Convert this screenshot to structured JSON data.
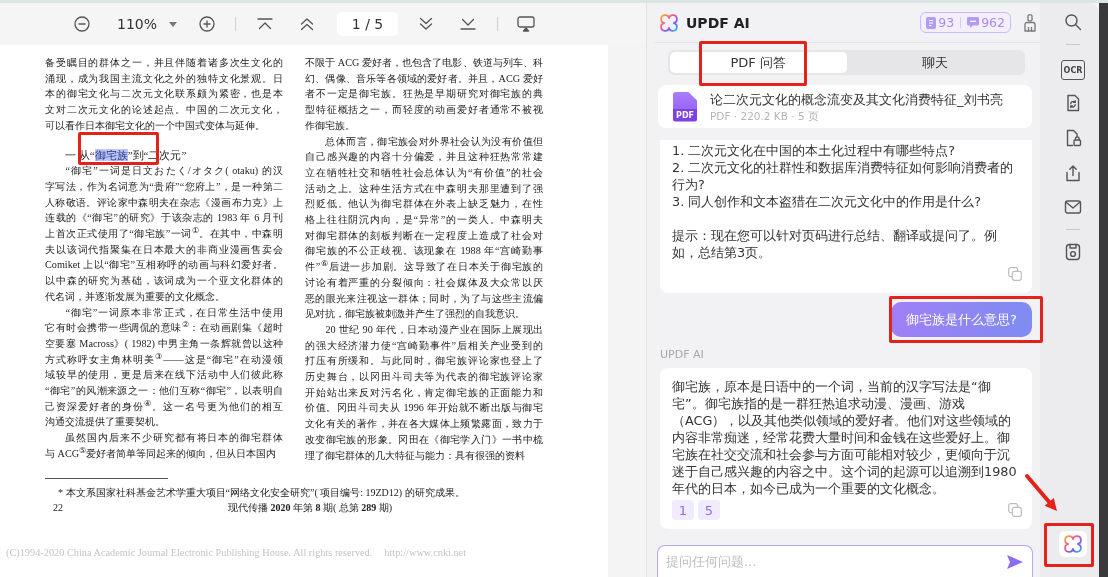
{
  "toolbar": {
    "zoom": "110%",
    "page": "1 / 5"
  },
  "pdf_page": {
    "columns": [
      {
        "blocks": [
          {
            "kind": "paragraph",
            "continued": true,
            "lines": [
              "备受瞩目的群体之一，并且伴随着诸多次生文化的",
              "涌现，成为我国主流文化之外的独特文化景观。日",
              "本的御宅文化与二次元文化联系颇为紧密，也是本",
              "文对二次元文化的论述起点。中国的二次元文化，",
              "可以看作日本御宅文化的一个中国式变体与延伸。"
            ]
          },
          {
            "kind": "heading",
            "segments": [
              {
                "text": "一 从“",
                "highlighted": false
              },
              {
                "text": "御宅族",
                "highlighted": true
              },
              {
                "text": "”到“二次元”",
                "highlighted": false
              }
            ]
          },
          {
            "kind": "paragraph",
            "continued": false,
            "lines": [
              "“御宅”一词是日文おたく/オタク( otaku) 的汉",
              "字写法，作为名词意为“贵府”“您府上”，是一种第二",
              "人称敬语。评论家中森明夫在杂志《漫画布力克》上",
              "连载的《“御宅”的研究》于该杂志的 1983 年 6 月刊",
              "上首次正式使用了“御宅族”一词$^{①}$。在其中，中森明",
              "夫以该词代指聚集在日本最大的非商业漫画售卖会",
              "Comiket 上以“御宅”互相称呼的动画与科幻爱好者。",
              "以中森的研究为基础，该词成为一个亚文化群体的",
              "代名词，并逐渐发展为重要的文化概念。"
            ]
          },
          {
            "kind": "paragraph",
            "continued": false,
            "lines": [
              "“御宅”一词原本非常正式，在日常生活中使用",
              "它有时会携带一些调侃的意味$^{②}$：在动画剧集《超时",
              "空要塞 Macross》( 1982) 中男主角一条辉就曾以这种",
              "方式称呼女主角林明美$^{③}$——这是“御宅”在动漫领",
              "域较早的使用，更是后来在线下活动中人们彼此称",
              "“御宅”的风潮来源之一：他们互称“御宅”，以表明自",
              "己资深爱好者的身份$^{④}$。这一名号更为他们的相互",
              "沟通交流提供了重要契机。"
            ]
          },
          {
            "kind": "paragraph",
            "continued": false,
            "lines": [
              "虽然国内后来不少研究都有将日本的御宅群体",
              "与 ACG$^{⑤}$爱好者简单等同起来的倾向，但从日本国内"
            ]
          }
        ]
      },
      {
        "blocks": [
          {
            "kind": "paragraph",
            "continued": true,
            "lines": [
              "不限于 ACG 爱好者，也包含了电影、铁道与列车、科",
              "幻、偶像、音乐等各领域的爱好者。并且，ACG 爱好",
              "者不一定是御宅族。狂热是早期研究对御宅族的典",
              "型特征概括之一，而轻度的动画爱好者通常不被视",
              "作御宅族。"
            ]
          },
          {
            "kind": "paragraph",
            "continued": false,
            "lines": [
              "总体而言，御宅族会对外界社会认为没有价值但",
              "自己感兴趣的内容十分偏爱，并且这种狂热常常建",
              "立在牺牲社交和牺牲社会总体认为“有价值”的社会",
              "活动之上。这种生活方式在中森明夫那里遭到了强",
              "烈贬低。他认为御宅群体在外表上缺乏魅力，在性",
              "格上往往阴沉内向，是“异常”的一类人。中森明夫",
              "对御宅群体的刻板判断在一定程度上造成了社会对",
              "御宅族的不公正歧视。该现象在 1988 年“宫崎勤事",
              "件”$^{⑥}$后进一步加剧。这导致了在日本关于御宅族的",
              "讨论有着严重的分裂倾向：社会媒体及大众常以厌",
              "恶的眼光来注视这一群体；同时，为了与这些主流偏",
              "见对抗，御宅族被刺激并产生了强烈的自我意识。"
            ]
          },
          {
            "kind": "paragraph",
            "continued": false,
            "lines": [
              "20 世纪 90 年代，日本动漫产业在国际上展现出",
              "的强大经济潜力使“宫崎勤事件”后相关产业受到的",
              "打压有所缓和。与此同时，御宅族评论家也登上了",
              "历史舞台，以冈田斗司夫等为代表的御宅族评论家",
              "开始站出来反对污名化，肯定御宅族的正面能力和",
              "价值。冈田斗司夫从 1996 年开始就不断出版与御宅",
              "文化有关的著作，并在各大媒体上频繁露面，致力于",
              "改变御宅族的形象。冈田在《御宅学入门》一书中梳",
              "理了御宅群体的几大特征与能力：具有很强的资料"
            ]
          }
        ]
      }
    ],
    "footnote": "* 本文系国家社科基金艺术学重大项目“网络文化安全研究”( 项目编号: 19ZD12) 的研究成果。",
    "page_number": "22",
    "journal": "现代传播 **2020** 年第 **8** 期( 总第 **289** 期)",
    "copyright": "(C)1994-2020 China Academic Journal Electronic Publishing House. All rights reserved.",
    "url": "http://www.cnki.net"
  },
  "ai_panel": {
    "title": "UPDF AI",
    "credits": {
      "documents": "93",
      "messages": "962"
    },
    "tabs": [
      {
        "label": "PDF 问答",
        "selected": true
      },
      {
        "label": "聊天",
        "selected": false
      }
    ],
    "file": {
      "icon_label": "PDF",
      "name": "论二次元文化的概念流变及其文化消费特征_刘书亮",
      "meta": "PDF · 220.2 KB · 5 页"
    },
    "messages": [
      {
        "kind": "assistant",
        "paragraphs": [
          [
            "1. 二次元文化在中国的本土化过程中有哪些特点?",
            "2. 二次元文化的社群性和数据库消费特征如何影响消费者的行为?",
            "3. 同人创作和文本盗猎在二次元文化中的作用是什么?"
          ],
          [
            "提示：现在您可以针对页码进行总结、翻译或提问了。例如，总结第3页。"
          ]
        ]
      },
      {
        "kind": "user",
        "text": "御宅族是什么意思?"
      },
      {
        "kind": "assistant",
        "sender": "UPDF AI",
        "paragraphs": [
          [
            "御宅族，原本是日语中的一个词，当前的汉字写法是“御宅”。御宅族指的是一群狂热追求动漫、漫画、游戏（ACG），以及其他类似领域的爱好者。他们对这些领域的内容非常痴迷，经常花费大量时间和金钱在这些爱好上。御宅族在社交交流和社会参与方面可能相对较少，更倾向于沉迷于自己感兴趣的内容之中。这个词的起源可以追溯到1980年代的日本，如今已成为一个重要的文化概念。"
          ]
        ],
        "page_refs": [
          "1",
          "5"
        ]
      }
    ],
    "input": {
      "placeholder": "提问任何问题..."
    }
  },
  "tool_sidebar": {
    "ocr_label": "OCR",
    "ai_button": {
      "active": true
    }
  }
}
